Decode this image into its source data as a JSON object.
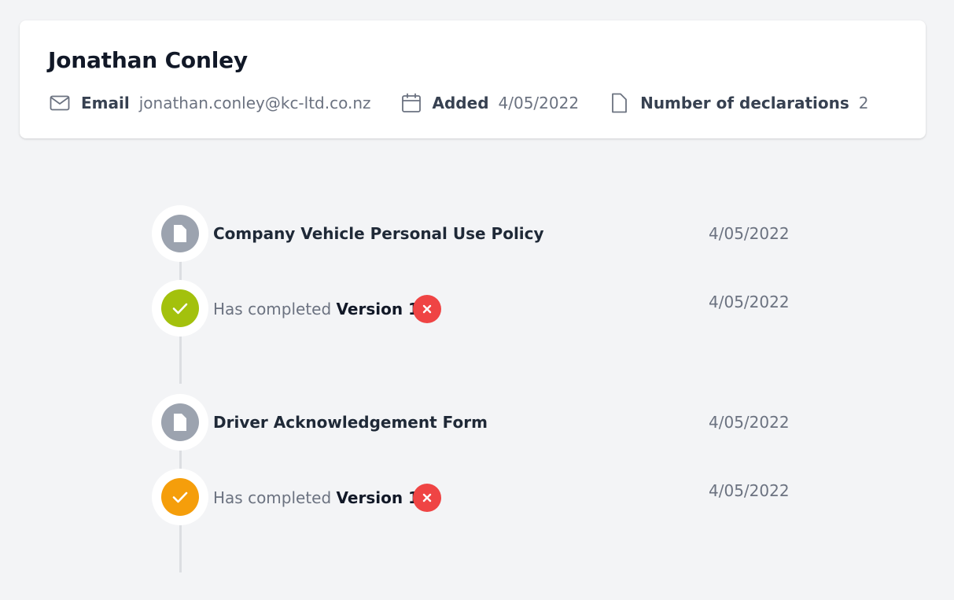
{
  "person": {
    "name": "Jonathan Conley",
    "email_label": "Email",
    "email": "jonathan.conley@kc-ltd.co.nz",
    "added_label": "Added",
    "added": "4/05/2022",
    "declarations_label": "Number of declarations",
    "declarations_count": "2"
  },
  "timeline": [
    {
      "title": "Company Vehicle Personal Use Policy",
      "date": "4/05/2022",
      "status_prefix": "Has completed",
      "version": "Version 1",
      "status_date": "4/05/2022",
      "status_color": "#a3c10d",
      "icon": "check-icon"
    },
    {
      "title": "Driver Acknowledgement Form",
      "date": "4/05/2022",
      "status_prefix": "Has completed",
      "version": "Version 1",
      "status_date": "4/05/2022",
      "status_color": "#f59e0b",
      "icon": "check-icon"
    }
  ],
  "colors": {
    "doc_node": "#9ca3af",
    "remove_button": "#ef4444",
    "background": "#f3f4f6"
  }
}
